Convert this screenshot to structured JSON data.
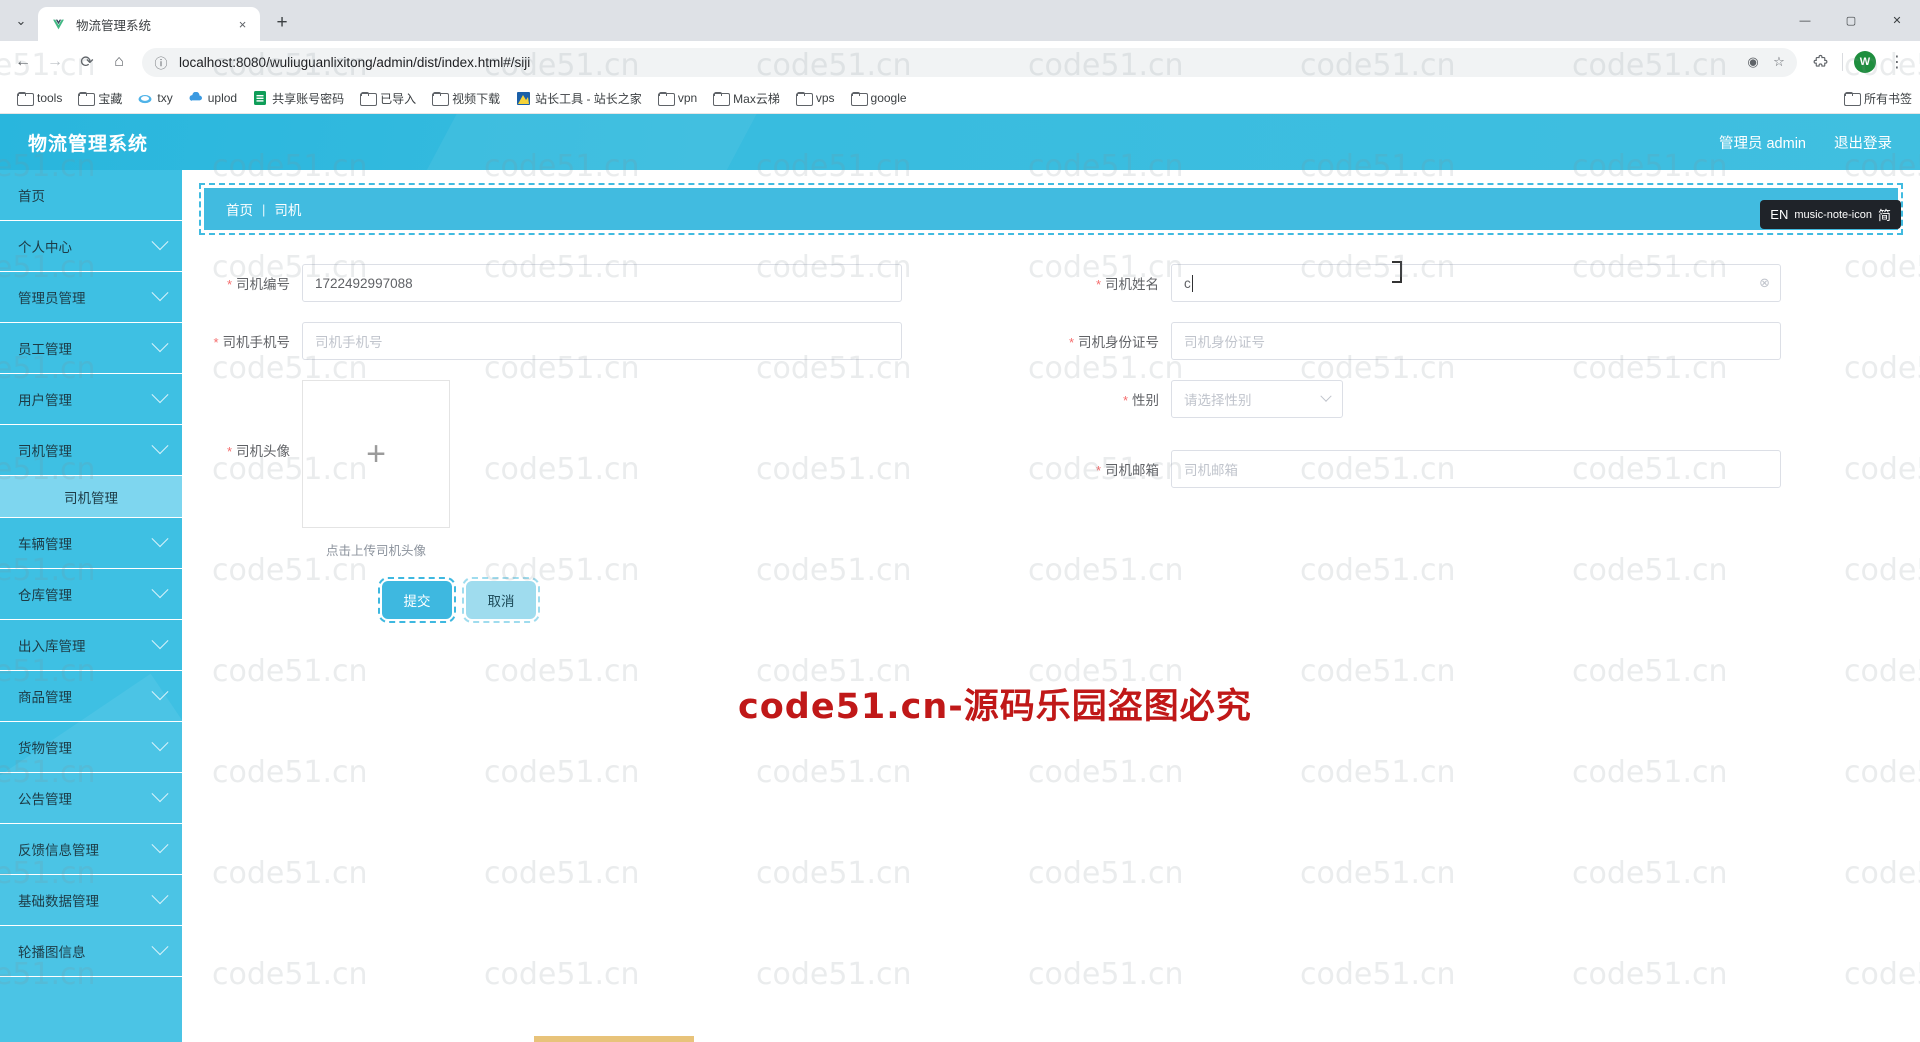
{
  "browser": {
    "tab": {
      "title": "物流管理系统",
      "favicon": "vue-logo-icon",
      "close": "×"
    },
    "new_tab": "+",
    "window_controls": {
      "minimize": "—",
      "maximize": "▢",
      "close": "✕"
    },
    "nav": {
      "back": "←",
      "forward": "→",
      "reload": "⟳",
      "home": "⌂"
    },
    "omnibox": {
      "info_icon": "info-icon",
      "url": "localhost:8080/wuliuguanlixitong/admin/dist/index.html#/siji",
      "lens_icon": "google-lens-icon",
      "bookmark_icon": "star-icon"
    },
    "extensions_icon": "puzzle-icon",
    "profile": {
      "initial": "W"
    },
    "menu_icon": "three-dot-menu-icon",
    "bookmarks": [
      {
        "label": "tools",
        "icon": "folder-icon"
      },
      {
        "label": "宝藏",
        "icon": "folder-icon"
      },
      {
        "label": "txy",
        "icon": "cloud-icon"
      },
      {
        "label": "uplod",
        "icon": "cloud-upload-icon"
      },
      {
        "label": "共享账号密码",
        "icon": "sheets-icon"
      },
      {
        "label": "已导入",
        "icon": "folder-icon"
      },
      {
        "label": "视频下载",
        "icon": "folder-icon"
      },
      {
        "label": "站长工具 - 站长之家",
        "icon": "chinaz-icon"
      },
      {
        "label": "vpn",
        "icon": "folder-icon"
      },
      {
        "label": "Max云梯",
        "icon": "folder-icon"
      },
      {
        "label": "vps",
        "icon": "folder-icon"
      },
      {
        "label": "google",
        "icon": "folder-icon"
      }
    ],
    "all_bookmarks": {
      "label": "所有书签",
      "icon": "folder-icon"
    }
  },
  "app": {
    "logo": "物流管理系统",
    "header_right": {
      "user": "管理员 admin",
      "logout": "退出登录"
    },
    "sidebar": [
      {
        "label": "首页",
        "has_children": false,
        "active": false
      },
      {
        "label": "个人中心",
        "has_children": true,
        "active": false
      },
      {
        "label": "管理员管理",
        "has_children": true,
        "active": false
      },
      {
        "label": "员工管理",
        "has_children": true,
        "active": false
      },
      {
        "label": "用户管理",
        "has_children": true,
        "active": false
      },
      {
        "label": "司机管理",
        "has_children": true,
        "active": true
      },
      {
        "label": "车辆管理",
        "has_children": true,
        "active": false
      },
      {
        "label": "仓库管理",
        "has_children": true,
        "active": false
      },
      {
        "label": "出入库管理",
        "has_children": true,
        "active": false
      },
      {
        "label": "商品管理",
        "has_children": true,
        "active": false
      },
      {
        "label": "货物管理",
        "has_children": true,
        "active": false
      },
      {
        "label": "公告管理",
        "has_children": true,
        "active": false
      },
      {
        "label": "反馈信息管理",
        "has_children": true,
        "active": false
      },
      {
        "label": "基础数据管理",
        "has_children": true,
        "active": false
      },
      {
        "label": "轮播图信息",
        "has_children": true,
        "active": false
      }
    ],
    "submenu": {
      "label": "司机管理",
      "parent_index": 5
    },
    "breadcrumb": {
      "home": "首页",
      "separator": "|",
      "current": "司机"
    },
    "lang_badge": {
      "en": "EN",
      "note_icon": "music-note-icon",
      "zh": "简"
    },
    "form": {
      "driver_no": {
        "label": "司机编号",
        "required": true,
        "value": "1722492997088",
        "placeholder": ""
      },
      "driver_name": {
        "label": "司机姓名",
        "required": true,
        "value": "c",
        "placeholder": "司机姓名",
        "clear_icon": "clear-circle-icon"
      },
      "driver_phone": {
        "label": "司机手机号",
        "required": true,
        "value": "",
        "placeholder": "司机手机号"
      },
      "driver_idcard": {
        "label": "司机身份证号",
        "required": true,
        "value": "",
        "placeholder": "司机身份证号"
      },
      "gender": {
        "label": "性别",
        "required": true,
        "value": "",
        "placeholder": "请选择性别",
        "chevron": "chevron-down-icon"
      },
      "driver_email": {
        "label": "司机邮箱",
        "required": true,
        "value": "",
        "placeholder": "司机邮箱"
      },
      "avatar": {
        "label": "司机头像",
        "required": true,
        "plus": "+",
        "hint": "点击上传司机头像"
      },
      "submit_button": "提交",
      "cancel_button": "取消"
    },
    "watermark_text": "code51.cn",
    "red_watermark": "code51.cn-源码乐园盗图必究"
  },
  "colors": {
    "brand": "#3ec0e3",
    "header_gradient_start": "#29b6dd",
    "sidebar": "#3ec0e3",
    "submenu_active": "#7ed6ef",
    "required_star": "#f56c6c",
    "red_watermark": "#c01818",
    "profile_avatar": "#1e8e3e"
  }
}
